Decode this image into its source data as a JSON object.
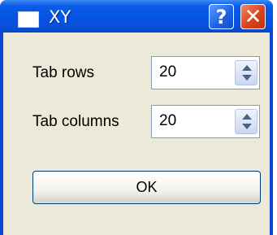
{
  "window": {
    "title": "XY",
    "help_label": "?",
    "close_label": "✕"
  },
  "form": {
    "rows_label": "Tab rows",
    "rows_value": "20",
    "columns_label": "Tab columns",
    "columns_value": "20"
  },
  "ok_label": "OK"
}
